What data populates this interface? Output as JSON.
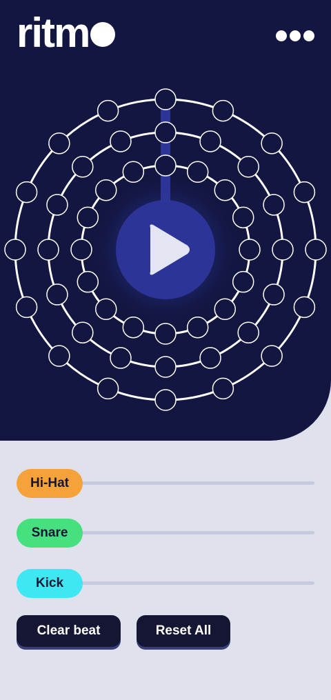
{
  "app": {
    "logo": "ritmo"
  },
  "header": {
    "menu_icon": "more-horizontal-icon"
  },
  "sequencer": {
    "play_icon": "play-icon",
    "rings": [
      {
        "name": "outer",
        "steps": 16
      },
      {
        "name": "middle",
        "steps": 16
      },
      {
        "name": "inner",
        "steps": 16
      }
    ],
    "active_step": 0
  },
  "tracks": [
    {
      "label": "Hi-Hat",
      "color": "#f5a23a"
    },
    {
      "label": "Snare",
      "color": "#46e07f"
    },
    {
      "label": "Kick",
      "color": "#3fe7f3"
    }
  ],
  "buttons": {
    "clear": "Clear beat",
    "reset": "Reset All"
  },
  "colors": {
    "background_dark": "#121641",
    "panel_light": "#dfe2ec",
    "play_button": "#2c3597",
    "step_fill": "#121641"
  }
}
